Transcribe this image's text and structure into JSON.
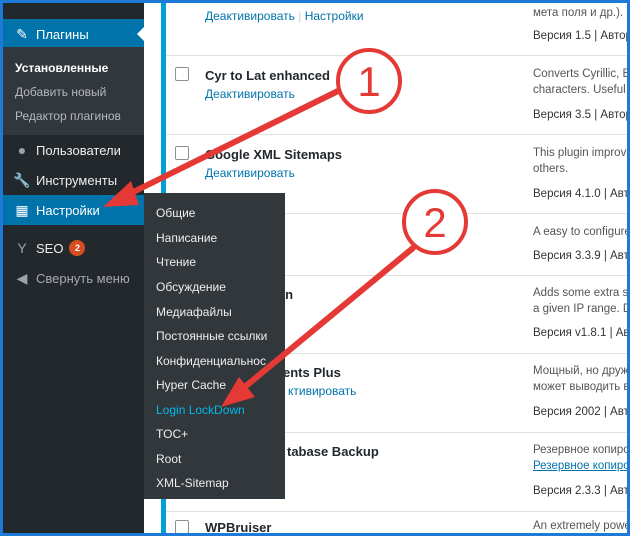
{
  "sidebar": {
    "plugins_label": "Плагины",
    "sub_installed": "Установленные",
    "sub_add_new": "Добавить новый",
    "sub_editor": "Редактор плагинов",
    "users_label": "Пользователи",
    "tools_label": "Инструменты",
    "settings_label": "Настройки",
    "seo_label": "SEO",
    "seo_badge": "2",
    "collapse_label": "Свернуть меню"
  },
  "flyout": {
    "items": [
      "Общие",
      "Написание",
      "Чтение",
      "Обсуждение",
      "Медиафайлы",
      "Постоянные ссылки",
      "Конфиденциальнос",
      "Hyper Cache",
      "Login LockDown",
      "TOC+",
      "Root",
      "XML-Sitemap"
    ]
  },
  "plugins": {
    "row0": {
      "deactivate": "Деактивировать",
      "separator": "|",
      "settings": "Настройки",
      "desc1": "мета поля и др.). Ip",
      "version": "Версия 1.5 | Автор"
    },
    "row1": {
      "name": "Cyr to Lat enhanced",
      "deactivate": "Деактивировать",
      "desc1": "Converts Cyrillic, Eu",
      "desc2": "characters. Useful f",
      "version": "Версия 3.5 | Автор"
    },
    "row2": {
      "name": "Google XML Sitemaps",
      "deactivate": "Деактивировать",
      "desc1": "This plugin improve",
      "desc2": "others.",
      "version": "Версия 4.1.0 | Автор"
    },
    "row3": {
      "desc1": "A easy to configure",
      "version": "Версия 3.3.9 | Автор"
    },
    "row4": {
      "name": "wn",
      "desc1": "Adds some extra se",
      "desc2": "a given IP range. De",
      "version": "Версия v1.8.1 | Авт"
    },
    "row5": {
      "name": "ents Plus",
      "deactivate": "ктивировать",
      "desc1": "Мощный, но друж",
      "desc2": "может выводить в",
      "version": "Версия 2002 | Авто"
    },
    "row6": {
      "name": "tabase Backup",
      "desc1": "Резервное копиро",
      "desc2": "Резервное копиро",
      "version": "Версия 2.3.3 | Авто"
    },
    "row7": {
      "name": "WPBruiser",
      "desc1": "An extremely powe"
    }
  },
  "annotations": {
    "marker1": "1",
    "marker2": "2",
    "color": "#e53935"
  }
}
